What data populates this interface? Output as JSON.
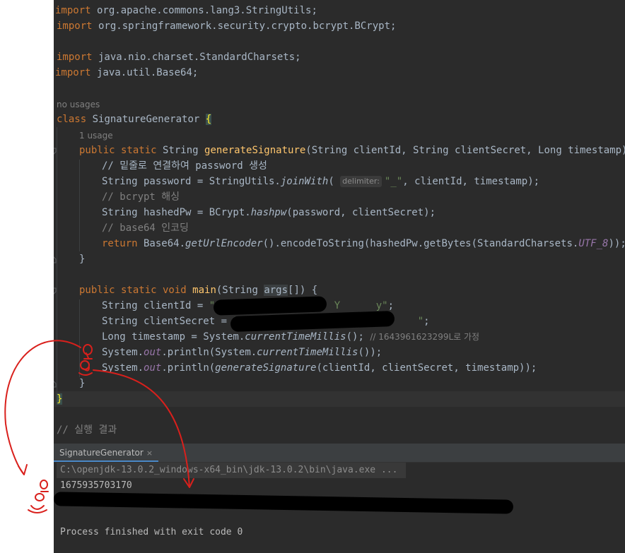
{
  "editor": {
    "imports": [
      "import org.apache.commons.lang3.StringUtils;",
      "import org.springframework.security.crypto.bcrypt.BCrypt;",
      "import java.nio.charset.StandardCharsets;",
      "import java.util.Base64;"
    ],
    "hint_no_usages": "no usages",
    "class_kw": "class",
    "class_name": "SignatureGenerator",
    "hint_usage": "1 usage",
    "comments": {
      "c1": "// 밑줄로 연결하여 password 생성",
      "c2": "// bcrypt 해싱",
      "c3": "// base64 인코딩",
      "c4": "// 1643961623299L로 가정"
    },
    "inlay_delimiter": "delimiter:",
    "result_comment": "// 실행 결과"
  },
  "console": {
    "tab_label": "SignatureGenerator",
    "tab_close": "×",
    "command": "C:\\openjdk-13.0.2_windows-x64_bin\\jdk-13.0.2\\bin\\java.exe ...",
    "output_1": "1675935703170",
    "exit_message": "Process finished with exit code 0"
  },
  "colors": {
    "editor_bg": "#2b2b2b",
    "keyword": "#cc7832",
    "method_decl": "#ffc66d",
    "string": "#6a8759",
    "comment": "#808080",
    "static_field": "#9876aa",
    "annotation_red": "#d9201c"
  }
}
